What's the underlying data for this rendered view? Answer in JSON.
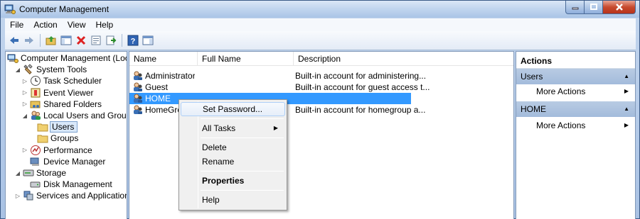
{
  "window": {
    "title": "Computer Management"
  },
  "menubar": [
    "File",
    "Action",
    "View",
    "Help"
  ],
  "toolbar": [
    "back-icon",
    "forward-icon",
    "up-folder-icon",
    "show-hide-tree-icon",
    "delete-icon",
    "properties-icon",
    "export-list-icon",
    "help-icon",
    "show-hide-action-pane-icon"
  ],
  "tree": [
    {
      "label": "Computer Management (Local",
      "indent": 0,
      "twisty": "",
      "icon": "computer-management-icon"
    },
    {
      "label": "System Tools",
      "indent": 1,
      "twisty": "expanded",
      "icon": "system-tools-icon"
    },
    {
      "label": "Task Scheduler",
      "indent": 2,
      "twisty": "collapsed",
      "icon": "clock-icon"
    },
    {
      "label": "Event Viewer",
      "indent": 2,
      "twisty": "collapsed",
      "icon": "event-viewer-icon"
    },
    {
      "label": "Shared Folders",
      "indent": 2,
      "twisty": "collapsed",
      "icon": "shared-folder-icon"
    },
    {
      "label": "Local Users and Groups",
      "indent": 2,
      "twisty": "expanded",
      "icon": "users-groups-icon"
    },
    {
      "label": "Users",
      "indent": 3,
      "twisty": "",
      "icon": "folder-icon",
      "selected": true
    },
    {
      "label": "Groups",
      "indent": 3,
      "twisty": "",
      "icon": "folder-icon"
    },
    {
      "label": "Performance",
      "indent": 2,
      "twisty": "collapsed",
      "icon": "performance-icon"
    },
    {
      "label": "Device Manager",
      "indent": 2,
      "twisty": "",
      "icon": "device-manager-icon"
    },
    {
      "label": "Storage",
      "indent": 1,
      "twisty": "expanded",
      "icon": "storage-icon"
    },
    {
      "label": "Disk Management",
      "indent": 2,
      "twisty": "",
      "icon": "disk-management-icon"
    },
    {
      "label": "Services and Applications",
      "indent": 1,
      "twisty": "collapsed",
      "icon": "services-icon"
    }
  ],
  "list": {
    "columns": [
      "Name",
      "Full Name",
      "Description"
    ],
    "rows": [
      {
        "name": "Administrator",
        "full_name": "",
        "description": "Built-in account for administering..."
      },
      {
        "name": "Guest",
        "full_name": "",
        "description": "Built-in account for guest access t..."
      },
      {
        "name": "HOME",
        "full_name": "",
        "description": "",
        "selected": true
      },
      {
        "name": "HomeGrou",
        "full_name": "",
        "description": "Built-in account for homegroup a..."
      }
    ]
  },
  "context_menu": {
    "items": [
      {
        "label": "Set Password...",
        "hover": true
      },
      {
        "sep": true
      },
      {
        "label": "All Tasks",
        "submenu": true
      },
      {
        "sep": true
      },
      {
        "label": "Delete"
      },
      {
        "label": "Rename"
      },
      {
        "sep": true
      },
      {
        "label": "Properties",
        "bold": true
      },
      {
        "sep": true
      },
      {
        "label": "Help"
      }
    ]
  },
  "actions": {
    "header": "Actions",
    "groups": [
      {
        "title": "Users",
        "links": [
          "More Actions"
        ]
      },
      {
        "title": "HOME",
        "links": [
          "More Actions"
        ]
      }
    ]
  },
  "colors": {
    "selection": "#3399ff",
    "action_group": "#a3bbdb"
  }
}
